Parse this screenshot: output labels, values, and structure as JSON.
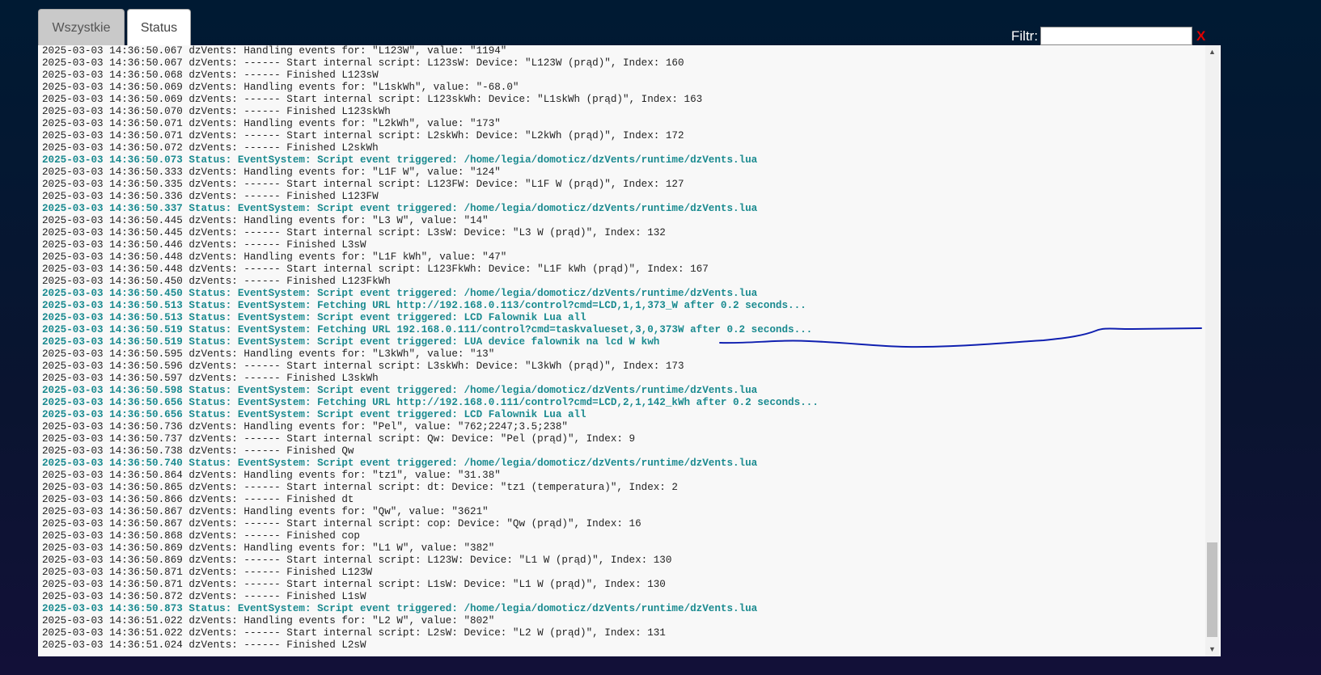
{
  "tabs": [
    {
      "label": "Wszystkie",
      "active": false
    },
    {
      "label": "Status",
      "active": true
    }
  ],
  "filter": {
    "label": "Filtr:",
    "value": "",
    "clear": "X"
  },
  "colors": {
    "status_line": "#1a8a8f",
    "annotation": "#1020b0"
  },
  "log_lines": [
    {
      "text": "2025-03-03 14:36:50.067 dzVents: Handling events for: \"L123W\", value: \"1194\"",
      "type": "normal"
    },
    {
      "text": "2025-03-03 14:36:50.067 dzVents: ------ Start internal script: L123sW: Device: \"L123W (prąd)\", Index: 160",
      "type": "normal"
    },
    {
      "text": "2025-03-03 14:36:50.068 dzVents: ------ Finished L123sW",
      "type": "normal"
    },
    {
      "text": "2025-03-03 14:36:50.069 dzVents: Handling events for: \"L1skWh\", value: \"-68.0\"",
      "type": "normal"
    },
    {
      "text": "2025-03-03 14:36:50.069 dzVents: ------ Start internal script: L123skWh: Device: \"L1skWh (prąd)\", Index: 163",
      "type": "normal"
    },
    {
      "text": "2025-03-03 14:36:50.070 dzVents: ------ Finished L123skWh",
      "type": "normal"
    },
    {
      "text": "2025-03-03 14:36:50.071 dzVents: Handling events for: \"L2kWh\", value: \"173\"",
      "type": "normal"
    },
    {
      "text": "2025-03-03 14:36:50.071 dzVents: ------ Start internal script: L2skWh: Device: \"L2kWh (prąd)\", Index: 172",
      "type": "normal"
    },
    {
      "text": "2025-03-03 14:36:50.072 dzVents: ------ Finished L2skWh",
      "type": "normal"
    },
    {
      "text": "2025-03-03 14:36:50.073 Status: EventSystem: Script event triggered: /home/legia/domoticz/dzVents/runtime/dzVents.lua",
      "type": "status"
    },
    {
      "text": "2025-03-03 14:36:50.333 dzVents: Handling events for: \"L1F W\", value: \"124\"",
      "type": "normal"
    },
    {
      "text": "2025-03-03 14:36:50.335 dzVents: ------ Start internal script: L123FW: Device: \"L1F W (prąd)\", Index: 127",
      "type": "normal"
    },
    {
      "text": "2025-03-03 14:36:50.336 dzVents: ------ Finished L123FW",
      "type": "normal"
    },
    {
      "text": "2025-03-03 14:36:50.337 Status: EventSystem: Script event triggered: /home/legia/domoticz/dzVents/runtime/dzVents.lua",
      "type": "status"
    },
    {
      "text": "2025-03-03 14:36:50.445 dzVents: Handling events for: \"L3 W\", value: \"14\"",
      "type": "normal"
    },
    {
      "text": "2025-03-03 14:36:50.445 dzVents: ------ Start internal script: L3sW: Device: \"L3 W (prąd)\", Index: 132",
      "type": "normal"
    },
    {
      "text": "2025-03-03 14:36:50.446 dzVents: ------ Finished L3sW",
      "type": "normal"
    },
    {
      "text": "2025-03-03 14:36:50.448 dzVents: Handling events for: \"L1F kWh\", value: \"47\"",
      "type": "normal"
    },
    {
      "text": "2025-03-03 14:36:50.448 dzVents: ------ Start internal script: L123FkWh: Device: \"L1F kWh (prąd)\", Index: 167",
      "type": "normal"
    },
    {
      "text": "2025-03-03 14:36:50.450 dzVents: ------ Finished L123FkWh",
      "type": "normal"
    },
    {
      "text": "2025-03-03 14:36:50.450 Status: EventSystem: Script event triggered: /home/legia/domoticz/dzVents/runtime/dzVents.lua",
      "type": "status"
    },
    {
      "text": "2025-03-03 14:36:50.513 Status: EventSystem: Fetching URL http://192.168.0.113/control?cmd=LCD,1,1,373_W after 0.2 seconds...",
      "type": "status"
    },
    {
      "text": "2025-03-03 14:36:50.513 Status: EventSystem: Script event triggered: LCD Falownik Lua all",
      "type": "status"
    },
    {
      "text": "2025-03-03 14:36:50.519 Status: EventSystem: Fetching URL 192.168.0.111/control?cmd=taskvalueset,3,0,373W after 0.2 seconds...",
      "type": "status"
    },
    {
      "text": "2025-03-03 14:36:50.519 Status: EventSystem: Script event triggered: LUA device falownik na lcd W kwh",
      "type": "status"
    },
    {
      "text": "2025-03-03 14:36:50.595 dzVents: Handling events for: \"L3kWh\", value: \"13\"",
      "type": "normal"
    },
    {
      "text": "2025-03-03 14:36:50.596 dzVents: ------ Start internal script: L3skWh: Device: \"L3kWh (prąd)\", Index: 173",
      "type": "normal"
    },
    {
      "text": "2025-03-03 14:36:50.597 dzVents: ------ Finished L3skWh",
      "type": "normal"
    },
    {
      "text": "2025-03-03 14:36:50.598 Status: EventSystem: Script event triggered: /home/legia/domoticz/dzVents/runtime/dzVents.lua",
      "type": "status"
    },
    {
      "text": "2025-03-03 14:36:50.656 Status: EventSystem: Fetching URL http://192.168.0.111/control?cmd=LCD,2,1,142_kWh after 0.2 seconds...",
      "type": "status"
    },
    {
      "text": "2025-03-03 14:36:50.656 Status: EventSystem: Script event triggered: LCD Falownik Lua all",
      "type": "status"
    },
    {
      "text": "2025-03-03 14:36:50.736 dzVents: Handling events for: \"Pel\", value: \"762;2247;3.5;238\"",
      "type": "normal"
    },
    {
      "text": "2025-03-03 14:36:50.737 dzVents: ------ Start internal script: Qw: Device: \"Pel (prąd)\", Index: 9",
      "type": "normal"
    },
    {
      "text": "2025-03-03 14:36:50.738 dzVents: ------ Finished Qw",
      "type": "normal"
    },
    {
      "text": "2025-03-03 14:36:50.740 Status: EventSystem: Script event triggered: /home/legia/domoticz/dzVents/runtime/dzVents.lua",
      "type": "status"
    },
    {
      "text": "2025-03-03 14:36:50.864 dzVents: Handling events for: \"tz1\", value: \"31.38\"",
      "type": "normal"
    },
    {
      "text": "2025-03-03 14:36:50.865 dzVents: ------ Start internal script: dt: Device: \"tz1 (temperatura)\", Index: 2",
      "type": "normal"
    },
    {
      "text": "2025-03-03 14:36:50.866 dzVents: ------ Finished dt",
      "type": "normal"
    },
    {
      "text": "2025-03-03 14:36:50.867 dzVents: Handling events for: \"Qw\", value: \"3621\"",
      "type": "normal"
    },
    {
      "text": "2025-03-03 14:36:50.867 dzVents: ------ Start internal script: cop: Device: \"Qw (prąd)\", Index: 16",
      "type": "normal"
    },
    {
      "text": "2025-03-03 14:36:50.868 dzVents: ------ Finished cop",
      "type": "normal"
    },
    {
      "text": "2025-03-03 14:36:50.869 dzVents: Handling events for: \"L1 W\", value: \"382\"",
      "type": "normal"
    },
    {
      "text": "2025-03-03 14:36:50.869 dzVents: ------ Start internal script: L123W: Device: \"L1 W (prąd)\", Index: 130",
      "type": "normal"
    },
    {
      "text": "2025-03-03 14:36:50.871 dzVents: ------ Finished L123W",
      "type": "normal"
    },
    {
      "text": "2025-03-03 14:36:50.871 dzVents: ------ Start internal script: L1sW: Device: \"L1 W (prąd)\", Index: 130",
      "type": "normal"
    },
    {
      "text": "2025-03-03 14:36:50.872 dzVents: ------ Finished L1sW",
      "type": "normal"
    },
    {
      "text": "2025-03-03 14:36:50.873 Status: EventSystem: Script event triggered: /home/legia/domoticz/dzVents/runtime/dzVents.lua",
      "type": "status"
    },
    {
      "text": "2025-03-03 14:36:51.022 dzVents: Handling events for: \"L2 W\", value: \"802\"",
      "type": "normal"
    },
    {
      "text": "2025-03-03 14:36:51.022 dzVents: ------ Start internal script: L2sW: Device: \"L2 W (prąd)\", Index: 131",
      "type": "normal"
    },
    {
      "text": "2025-03-03 14:36:51.024 dzVents: ------ Finished L2sW",
      "type": "normal"
    }
  ]
}
